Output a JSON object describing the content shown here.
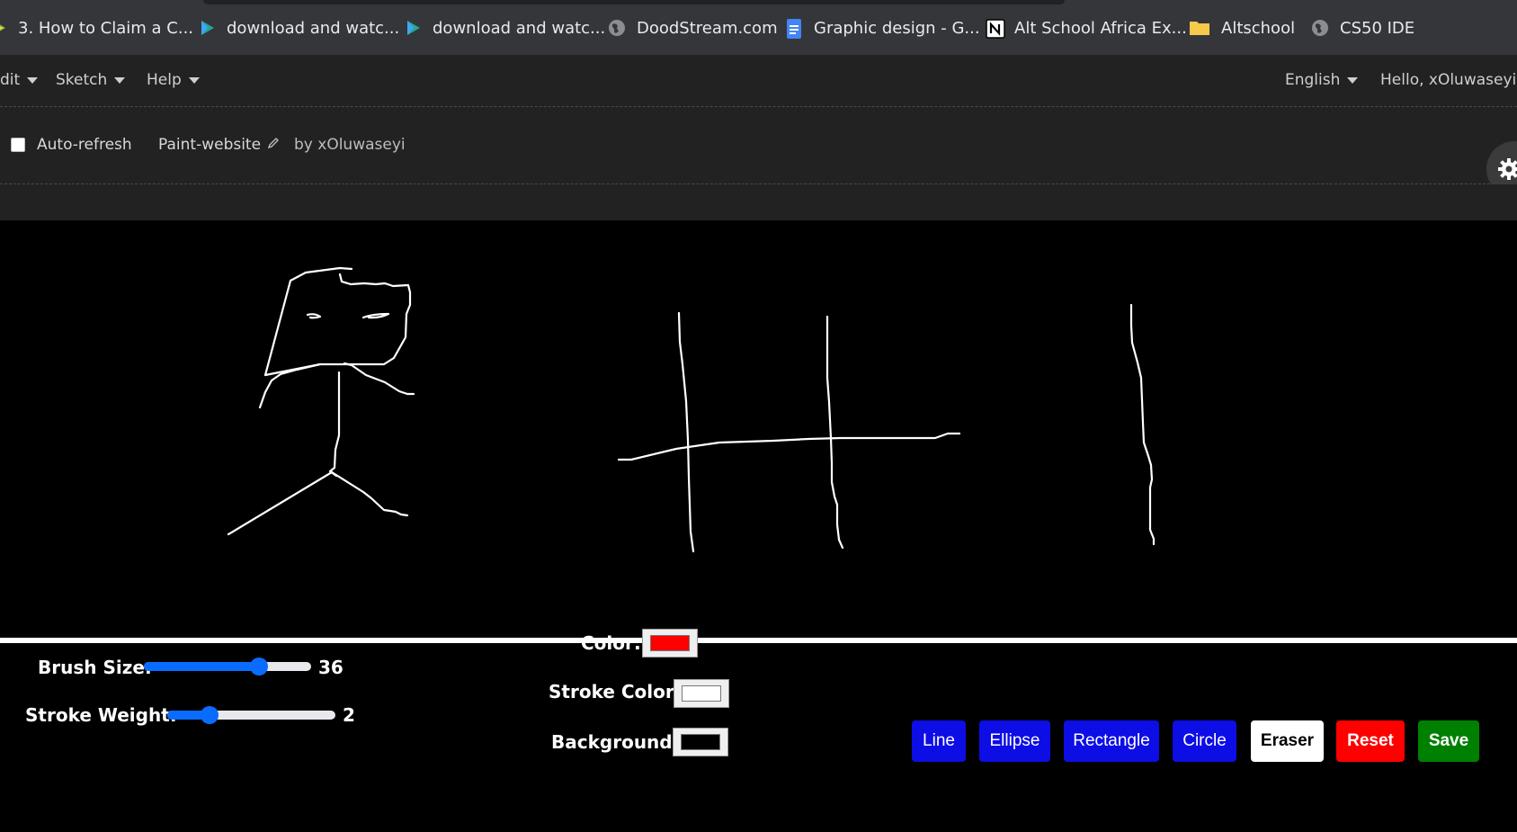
{
  "bookmarks": [
    {
      "label": "3. How to Claim a C...",
      "icon": "leaf-icon"
    },
    {
      "label": "download and watc...",
      "icon": "play-icon"
    },
    {
      "label": "download and watc...",
      "icon": "play-icon"
    },
    {
      "label": "DoodStream.com",
      "icon": "globe-icon"
    },
    {
      "label": "Graphic design - G...",
      "icon": "google-docs-icon"
    },
    {
      "label": "Alt School Africa Ex...",
      "icon": "notion-icon"
    },
    {
      "label": "Altschool",
      "icon": "folder-icon"
    },
    {
      "label": "CS50 IDE",
      "icon": "globe-icon"
    }
  ],
  "menubar": {
    "edit_label": "dit",
    "sketch_label": "Sketch",
    "help_label": "Help",
    "language_label": "English",
    "greeting": "Hello, xOluwaseyi!"
  },
  "toolbar": {
    "auto_refresh_label": "Auto-refresh",
    "sketch_name": "Paint-website",
    "author": "by xOluwaseyi"
  },
  "controls": {
    "brush_size_label": "Brush Size:",
    "brush_size_value": "36",
    "brush_size_fraction": 0.69,
    "stroke_weight_label": "Stroke Weight:",
    "stroke_weight_value": "2",
    "stroke_weight_fraction": 0.25,
    "color_label": "Color:",
    "stroke_color_label": "Stroke Color:",
    "background_label": "Background:",
    "color_value": "#ff0000",
    "stroke_color_value": "#ffffff",
    "background_value": "#000000"
  },
  "buttons": {
    "line": "Line",
    "ellipse": "Ellipse",
    "rectangle": "Rectangle",
    "circle": "Circle",
    "eraser": "Eraser",
    "reset": "Reset",
    "save": "Save"
  },
  "colors": {
    "blue_button": "#0d0de6",
    "eraser_button": "#ffffff",
    "reset_button": "#ff0000",
    "save_button": "#008000"
  }
}
